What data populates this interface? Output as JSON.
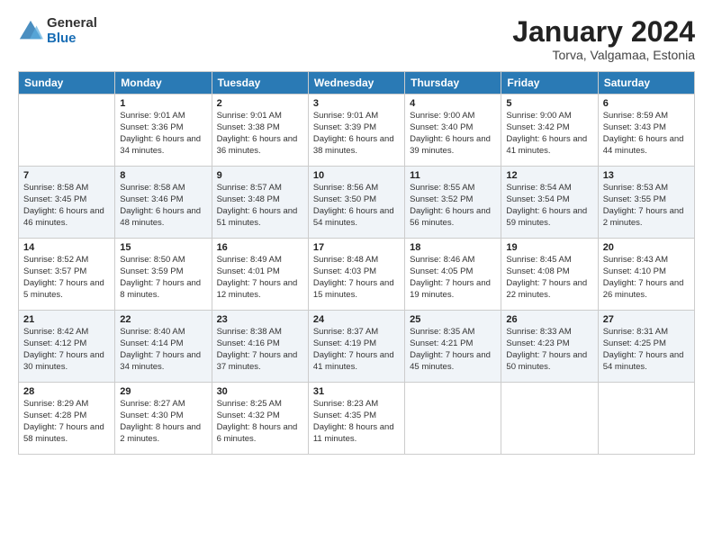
{
  "logo": {
    "general": "General",
    "blue": "Blue"
  },
  "title": "January 2024",
  "location": "Torva, Valgamaa, Estonia",
  "days_header": [
    "Sunday",
    "Monday",
    "Tuesday",
    "Wednesday",
    "Thursday",
    "Friday",
    "Saturday"
  ],
  "weeks": [
    [
      {
        "day": "",
        "sunrise": "",
        "sunset": "",
        "daylight": ""
      },
      {
        "day": "1",
        "sunrise": "Sunrise: 9:01 AM",
        "sunset": "Sunset: 3:36 PM",
        "daylight": "Daylight: 6 hours and 34 minutes."
      },
      {
        "day": "2",
        "sunrise": "Sunrise: 9:01 AM",
        "sunset": "Sunset: 3:38 PM",
        "daylight": "Daylight: 6 hours and 36 minutes."
      },
      {
        "day": "3",
        "sunrise": "Sunrise: 9:01 AM",
        "sunset": "Sunset: 3:39 PM",
        "daylight": "Daylight: 6 hours and 38 minutes."
      },
      {
        "day": "4",
        "sunrise": "Sunrise: 9:00 AM",
        "sunset": "Sunset: 3:40 PM",
        "daylight": "Daylight: 6 hours and 39 minutes."
      },
      {
        "day": "5",
        "sunrise": "Sunrise: 9:00 AM",
        "sunset": "Sunset: 3:42 PM",
        "daylight": "Daylight: 6 hours and 41 minutes."
      },
      {
        "day": "6",
        "sunrise": "Sunrise: 8:59 AM",
        "sunset": "Sunset: 3:43 PM",
        "daylight": "Daylight: 6 hours and 44 minutes."
      }
    ],
    [
      {
        "day": "7",
        "sunrise": "Sunrise: 8:58 AM",
        "sunset": "Sunset: 3:45 PM",
        "daylight": "Daylight: 6 hours and 46 minutes."
      },
      {
        "day": "8",
        "sunrise": "Sunrise: 8:58 AM",
        "sunset": "Sunset: 3:46 PM",
        "daylight": "Daylight: 6 hours and 48 minutes."
      },
      {
        "day": "9",
        "sunrise": "Sunrise: 8:57 AM",
        "sunset": "Sunset: 3:48 PM",
        "daylight": "Daylight: 6 hours and 51 minutes."
      },
      {
        "day": "10",
        "sunrise": "Sunrise: 8:56 AM",
        "sunset": "Sunset: 3:50 PM",
        "daylight": "Daylight: 6 hours and 54 minutes."
      },
      {
        "day": "11",
        "sunrise": "Sunrise: 8:55 AM",
        "sunset": "Sunset: 3:52 PM",
        "daylight": "Daylight: 6 hours and 56 minutes."
      },
      {
        "day": "12",
        "sunrise": "Sunrise: 8:54 AM",
        "sunset": "Sunset: 3:54 PM",
        "daylight": "Daylight: 6 hours and 59 minutes."
      },
      {
        "day": "13",
        "sunrise": "Sunrise: 8:53 AM",
        "sunset": "Sunset: 3:55 PM",
        "daylight": "Daylight: 7 hours and 2 minutes."
      }
    ],
    [
      {
        "day": "14",
        "sunrise": "Sunrise: 8:52 AM",
        "sunset": "Sunset: 3:57 PM",
        "daylight": "Daylight: 7 hours and 5 minutes."
      },
      {
        "day": "15",
        "sunrise": "Sunrise: 8:50 AM",
        "sunset": "Sunset: 3:59 PM",
        "daylight": "Daylight: 7 hours and 8 minutes."
      },
      {
        "day": "16",
        "sunrise": "Sunrise: 8:49 AM",
        "sunset": "Sunset: 4:01 PM",
        "daylight": "Daylight: 7 hours and 12 minutes."
      },
      {
        "day": "17",
        "sunrise": "Sunrise: 8:48 AM",
        "sunset": "Sunset: 4:03 PM",
        "daylight": "Daylight: 7 hours and 15 minutes."
      },
      {
        "day": "18",
        "sunrise": "Sunrise: 8:46 AM",
        "sunset": "Sunset: 4:05 PM",
        "daylight": "Daylight: 7 hours and 19 minutes."
      },
      {
        "day": "19",
        "sunrise": "Sunrise: 8:45 AM",
        "sunset": "Sunset: 4:08 PM",
        "daylight": "Daylight: 7 hours and 22 minutes."
      },
      {
        "day": "20",
        "sunrise": "Sunrise: 8:43 AM",
        "sunset": "Sunset: 4:10 PM",
        "daylight": "Daylight: 7 hours and 26 minutes."
      }
    ],
    [
      {
        "day": "21",
        "sunrise": "Sunrise: 8:42 AM",
        "sunset": "Sunset: 4:12 PM",
        "daylight": "Daylight: 7 hours and 30 minutes."
      },
      {
        "day": "22",
        "sunrise": "Sunrise: 8:40 AM",
        "sunset": "Sunset: 4:14 PM",
        "daylight": "Daylight: 7 hours and 34 minutes."
      },
      {
        "day": "23",
        "sunrise": "Sunrise: 8:38 AM",
        "sunset": "Sunset: 4:16 PM",
        "daylight": "Daylight: 7 hours and 37 minutes."
      },
      {
        "day": "24",
        "sunrise": "Sunrise: 8:37 AM",
        "sunset": "Sunset: 4:19 PM",
        "daylight": "Daylight: 7 hours and 41 minutes."
      },
      {
        "day": "25",
        "sunrise": "Sunrise: 8:35 AM",
        "sunset": "Sunset: 4:21 PM",
        "daylight": "Daylight: 7 hours and 45 minutes."
      },
      {
        "day": "26",
        "sunrise": "Sunrise: 8:33 AM",
        "sunset": "Sunset: 4:23 PM",
        "daylight": "Daylight: 7 hours and 50 minutes."
      },
      {
        "day": "27",
        "sunrise": "Sunrise: 8:31 AM",
        "sunset": "Sunset: 4:25 PM",
        "daylight": "Daylight: 7 hours and 54 minutes."
      }
    ],
    [
      {
        "day": "28",
        "sunrise": "Sunrise: 8:29 AM",
        "sunset": "Sunset: 4:28 PM",
        "daylight": "Daylight: 7 hours and 58 minutes."
      },
      {
        "day": "29",
        "sunrise": "Sunrise: 8:27 AM",
        "sunset": "Sunset: 4:30 PM",
        "daylight": "Daylight: 8 hours and 2 minutes."
      },
      {
        "day": "30",
        "sunrise": "Sunrise: 8:25 AM",
        "sunset": "Sunset: 4:32 PM",
        "daylight": "Daylight: 8 hours and 6 minutes."
      },
      {
        "day": "31",
        "sunrise": "Sunrise: 8:23 AM",
        "sunset": "Sunset: 4:35 PM",
        "daylight": "Daylight: 8 hours and 11 minutes."
      },
      {
        "day": "",
        "sunrise": "",
        "sunset": "",
        "daylight": ""
      },
      {
        "day": "",
        "sunrise": "",
        "sunset": "",
        "daylight": ""
      },
      {
        "day": "",
        "sunrise": "",
        "sunset": "",
        "daylight": ""
      }
    ]
  ]
}
